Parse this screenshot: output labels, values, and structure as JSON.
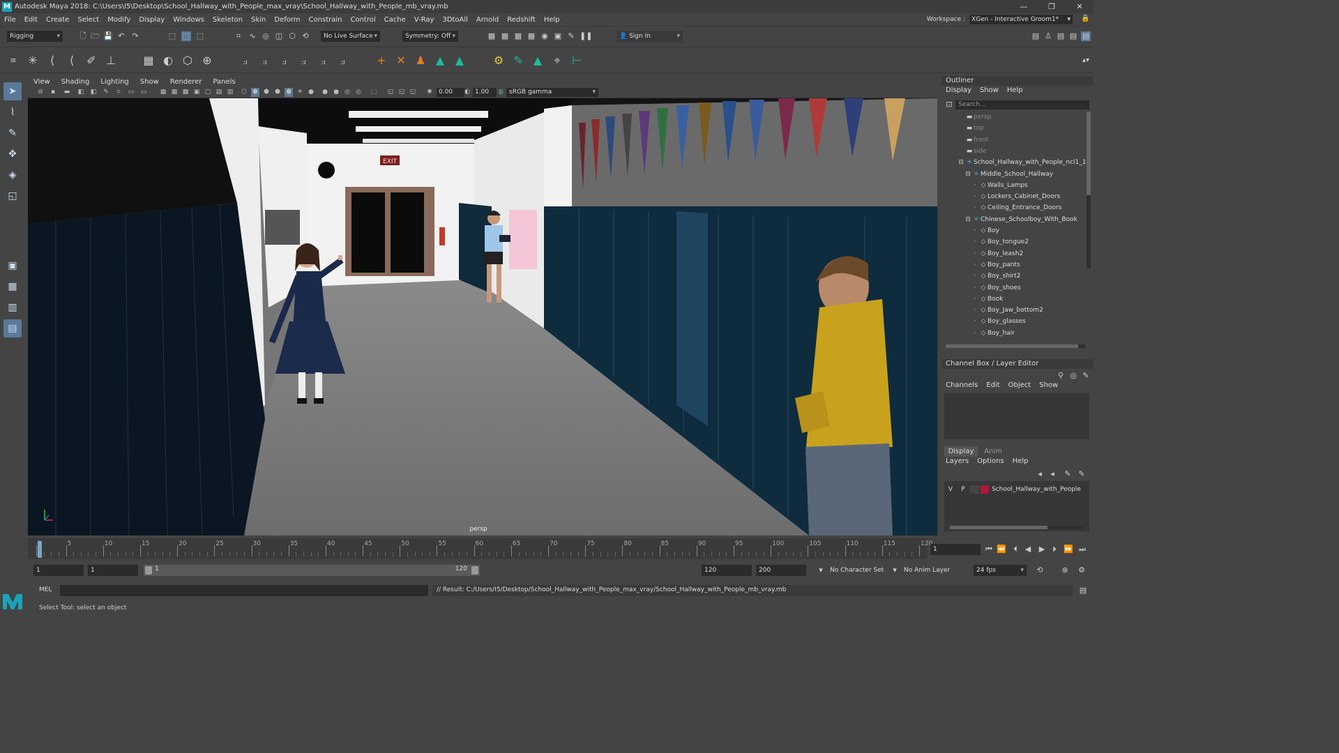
{
  "window": {
    "title": "Autodesk Maya 2018: C:\\Users\\I5\\Desktop\\School_Hallway_with_People_max_vray\\School_Hallway_with_People_mb_vray.mb"
  },
  "menu": [
    "File",
    "Edit",
    "Create",
    "Select",
    "Modify",
    "Display",
    "Windows",
    "Skeleton",
    "Skin",
    "Deform",
    "Constrain",
    "Control",
    "Cache",
    "V-Ray",
    "3DtoAll",
    "Arnold",
    "Redshift",
    "Help"
  ],
  "workspace": {
    "label": "Workspace :",
    "value": "XGen - Interactive Groom1*"
  },
  "statusline": {
    "mode": "Rigging",
    "live_surface": "No Live Surface",
    "symmetry": "Symmetry: Off",
    "sign_in": "Sign In"
  },
  "viewport": {
    "menu": [
      "View",
      "Shading",
      "Lighting",
      "Show",
      "Renderer",
      "Panels"
    ],
    "exposure": "0.00",
    "gamma": "1.00",
    "color_space": "sRGB gamma",
    "camera_label": "persp",
    "exit_sign": "EXIT"
  },
  "outliner": {
    "title": "Outliner",
    "menu": [
      "Display",
      "Show",
      "Help"
    ],
    "search_placeholder": "Search...",
    "items": [
      {
        "label": "persp",
        "indent": 0,
        "icon": "camera-icon",
        "dim": true
      },
      {
        "label": "top",
        "indent": 0,
        "icon": "camera-icon",
        "dim": true
      },
      {
        "label": "front",
        "indent": 0,
        "icon": "camera-icon",
        "dim": true
      },
      {
        "label": "side",
        "indent": 0,
        "icon": "camera-icon",
        "dim": true
      },
      {
        "label": "School_Hallway_with_People_ncl1_1",
        "indent": 0,
        "icon": "group-icon",
        "dim": false
      },
      {
        "label": "Middle_School_Hallway",
        "indent": 1,
        "icon": "group-icon",
        "dim": false
      },
      {
        "label": "Walls_Lamps",
        "indent": 2,
        "icon": "mesh-icon",
        "dim": false
      },
      {
        "label": "Lockers_Cabinet_Doors",
        "indent": 2,
        "icon": "mesh-icon",
        "dim": false
      },
      {
        "label": "Ceiling_Entrance_Doors",
        "indent": 2,
        "icon": "mesh-icon",
        "dim": false
      },
      {
        "label": "Chinese_Schoolboy_With_Book",
        "indent": 1,
        "icon": "group-icon",
        "dim": false
      },
      {
        "label": "Boy",
        "indent": 2,
        "icon": "mesh-icon",
        "dim": false
      },
      {
        "label": "Boy_tongue2",
        "indent": 2,
        "icon": "mesh-icon",
        "dim": false
      },
      {
        "label": "Boy_leash2",
        "indent": 2,
        "icon": "mesh-icon",
        "dim": false
      },
      {
        "label": "Boy_pants",
        "indent": 2,
        "icon": "mesh-icon",
        "dim": false
      },
      {
        "label": "Boy_shirt2",
        "indent": 2,
        "icon": "mesh-icon",
        "dim": false
      },
      {
        "label": "Boy_shoes",
        "indent": 2,
        "icon": "mesh-icon",
        "dim": false
      },
      {
        "label": "Book",
        "indent": 2,
        "icon": "mesh-icon",
        "dim": false
      },
      {
        "label": "Boy_Jaw_bottom2",
        "indent": 2,
        "icon": "mesh-icon",
        "dim": false
      },
      {
        "label": "Boy_glasses",
        "indent": 2,
        "icon": "mesh-icon",
        "dim": false
      },
      {
        "label": "Boy_hair",
        "indent": 2,
        "icon": "mesh-icon",
        "dim": false
      }
    ]
  },
  "channel_box": {
    "title": "Channel Box / Layer Editor",
    "menu": [
      "Channels",
      "Edit",
      "Object",
      "Show"
    ]
  },
  "layer_editor": {
    "tabs": [
      "Display",
      "Anim"
    ],
    "menu": [
      "Layers",
      "Options",
      "Help"
    ],
    "layer": {
      "v": "V",
      "p": "P",
      "name": "School_Hallway_with_People",
      "color": "#b0173a"
    }
  },
  "timeline": {
    "ticks": [
      1,
      5,
      10,
      15,
      20,
      25,
      30,
      35,
      40,
      45,
      50,
      55,
      60,
      65,
      70,
      75,
      80,
      85,
      90,
      95,
      100,
      105,
      110,
      115,
      120
    ],
    "current_frame": "1"
  },
  "range": {
    "start": "1",
    "playback_start": "1",
    "slider_start": "1",
    "slider_end": "120",
    "playback_end": "120",
    "end": "200",
    "character_set": "No Character Set",
    "anim_layer": "No Anim Layer",
    "fps": "24 fps"
  },
  "command": {
    "lang": "MEL",
    "result": "// Result: C:/Users/I5/Desktop/School_Hallway_with_People_max_vray/School_Hallway_with_People_mb_vray.mb"
  },
  "help_line": "Select Tool: select an object"
}
